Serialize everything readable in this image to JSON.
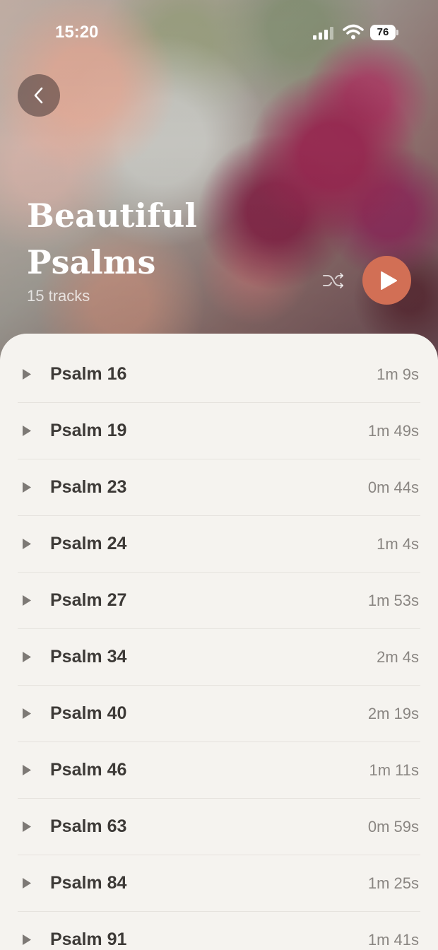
{
  "status_bar": {
    "time": "15:20",
    "battery_level": "76",
    "icons": [
      "signal-icon",
      "wifi-icon",
      "battery-icon"
    ]
  },
  "header": {
    "back_icon": "chevron-left-icon",
    "title": "Beautiful Psalms",
    "track_count": "15 tracks",
    "shuffle_icon": "shuffle-icon",
    "play_icon": "play-icon",
    "accent_color": "#d26f55"
  },
  "tracks": [
    {
      "title": "Psalm 16",
      "duration": "1m 9s"
    },
    {
      "title": "Psalm 19",
      "duration": "1m 49s"
    },
    {
      "title": "Psalm 23",
      "duration": "0m 44s"
    },
    {
      "title": "Psalm 24",
      "duration": "1m 4s"
    },
    {
      "title": "Psalm 27",
      "duration": "1m 53s"
    },
    {
      "title": "Psalm 34",
      "duration": "2m 4s"
    },
    {
      "title": "Psalm 40",
      "duration": "2m 19s"
    },
    {
      "title": "Psalm 46",
      "duration": "1m 11s"
    },
    {
      "title": "Psalm 63",
      "duration": "0m 59s"
    },
    {
      "title": "Psalm 84",
      "duration": "1m 25s"
    },
    {
      "title": "Psalm 91",
      "duration": "1m 41s"
    }
  ]
}
